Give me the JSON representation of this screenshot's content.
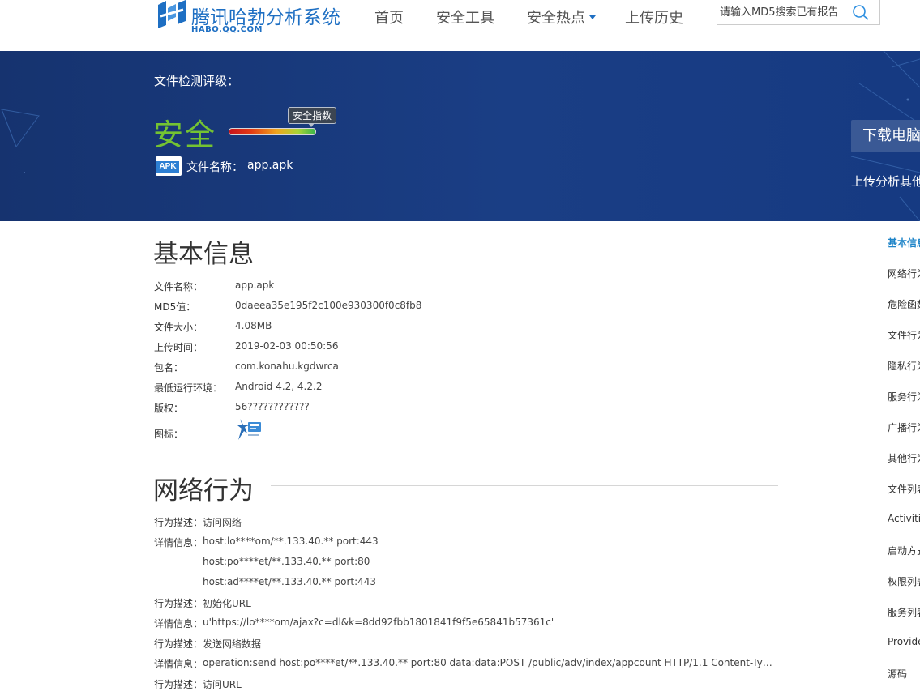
{
  "header": {
    "logo_title": "腾讯哈勃分析系统",
    "logo_sub": "HABO.QQ.COM",
    "nav": [
      "首页",
      "安全工具",
      "安全热点",
      "上传历史"
    ],
    "search_placeholder": "请输入MD5搜索已有报告"
  },
  "banner": {
    "rating_label": "文件检测评级：",
    "rating_value": "安全",
    "score_tip": "安全指数",
    "apk_badge": "APK",
    "file_label": "文件名称：",
    "file_name": "app.apk",
    "download_label": "下载电脑",
    "upload_label": "上传分析其他"
  },
  "basic_info": {
    "title": "基本信息",
    "rows": [
      {
        "label": "文件名称：",
        "value": "app.apk"
      },
      {
        "label": "MD5值：",
        "value": "0daeea35e195f2c100e930300f0c8fb8"
      },
      {
        "label": "文件大小：",
        "value": "4.08MB"
      },
      {
        "label": "上传时间：",
        "value": "2019-02-03 00:50:56"
      },
      {
        "label": "包名：",
        "value": "com.konahu.kgdwrca"
      },
      {
        "label": "最低运行环境：",
        "value": "Android 4.2, 4.2.2"
      },
      {
        "label": "版权：",
        "value": "56????????????"
      }
    ],
    "icon_label": "图标："
  },
  "network": {
    "title": "网络行为",
    "rows": [
      {
        "label": "行为描述：",
        "value": "访问网络"
      },
      {
        "label": "详情信息：",
        "value": "host:lo****om/**.133.40.** port:443"
      },
      {
        "label": "",
        "value": "host:po****et/**.133.40.** port:80"
      },
      {
        "label": "",
        "value": "host:ad****et/**.133.40.** port:443"
      },
      {
        "label": "行为描述：",
        "value": "初始化URL"
      },
      {
        "label": "详情信息：",
        "value": "u'https://lo****om/ajax?c=dl&k=8dd92fbb1801841f9f5e65841b57361c'"
      },
      {
        "label": "行为描述：",
        "value": "发送网络数据"
      },
      {
        "label": "详情信息：",
        "value": "operation:send host:po****et/**.133.40.** port:80 data:data:POST /public/adv/index/appcount HTTP/1.1 Content-Type: application/x-www-form-urlencoded"
      },
      {
        "label": "行为描述：",
        "value": "访问URL"
      }
    ]
  },
  "side_nav": {
    "items": [
      "基本信息",
      "网络行为",
      "危险函数",
      "文件行为",
      "隐私行为",
      "服务行为",
      "广播行为",
      "其他行为",
      "文件列表",
      "Activities",
      "启动方式",
      "权限列表",
      "服务列表",
      "Providers",
      "源码"
    ],
    "active_index": 0
  },
  "colors": {
    "brand": "#1e6fc3",
    "banner": "#1a3e85",
    "safe_green": "#74c332",
    "active_link": "#1e84c8"
  }
}
